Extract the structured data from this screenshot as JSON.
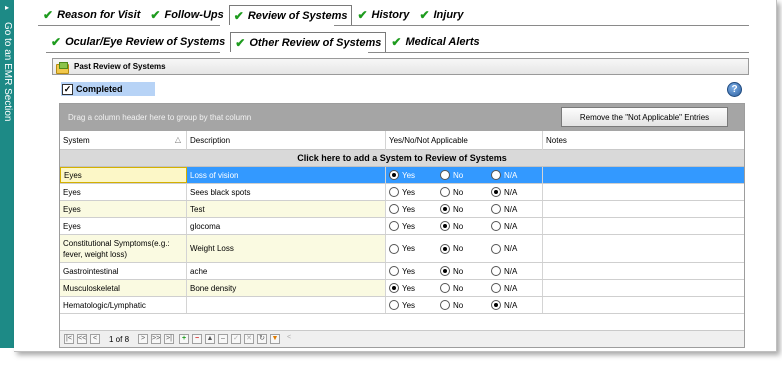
{
  "sidebar": {
    "label": "Go to an EMR Section",
    "arrow": "▸"
  },
  "tabs_top": [
    {
      "label": "Reason for Visit",
      "active": false
    },
    {
      "label": "Follow-Ups",
      "active": false
    },
    {
      "label": "Review of Systems",
      "active": true
    },
    {
      "label": "History",
      "active": false
    },
    {
      "label": "Injury",
      "active": false
    }
  ],
  "tabs_sub": [
    {
      "label": "Ocular/Eye Review of Systems",
      "active": false
    },
    {
      "label": "Other Review of Systems",
      "active": true
    },
    {
      "label": "Medical Alerts",
      "active": false
    }
  ],
  "check_glyph": "✔",
  "panel": {
    "title": "Past Review of Systems"
  },
  "completed": {
    "label": "Completed",
    "checked": true,
    "mark": "✓"
  },
  "help": {
    "glyph": "?"
  },
  "grid": {
    "group_hint": "Drag a column header here to group by that column",
    "remove_button": "Remove the \"Not Applicable\" Entries",
    "columns": [
      "System",
      "Description",
      "Yes/No/Not Applicable",
      "Notes"
    ],
    "sort_glyph": "△",
    "add_row": "Click here to add a System to Review of Systems",
    "options": [
      "Yes",
      "No",
      "N/A"
    ],
    "rows": [
      {
        "system": "Eyes",
        "description": "Loss of vision",
        "value": "Yes",
        "notes": ""
      },
      {
        "system": "Eyes",
        "description": "Sees black spots",
        "value": "N/A",
        "notes": ""
      },
      {
        "system": "Eyes",
        "description": "Test",
        "value": "No",
        "notes": ""
      },
      {
        "system": "Eyes",
        "description": "glocoma",
        "value": "No",
        "notes": ""
      },
      {
        "system": "Constitutional Symptoms(e.g.: fever, weight loss)",
        "description": "Weight Loss",
        "value": "No",
        "notes": ""
      },
      {
        "system": "Gastrointestinal",
        "description": "ache",
        "value": "No",
        "notes": ""
      },
      {
        "system": "Musculoskeletal",
        "description": "Bone density",
        "value": "Yes",
        "notes": ""
      },
      {
        "system": "Hematologic/Lymphatic",
        "description": "",
        "value": "N/A",
        "notes": ""
      }
    ],
    "pager": {
      "text": "1 of 8"
    }
  },
  "colors": {
    "sidebar": "#1d8a86",
    "selected_row": "#3399ff",
    "check": "#1e9b1e",
    "alt_row": "#fafae1"
  }
}
